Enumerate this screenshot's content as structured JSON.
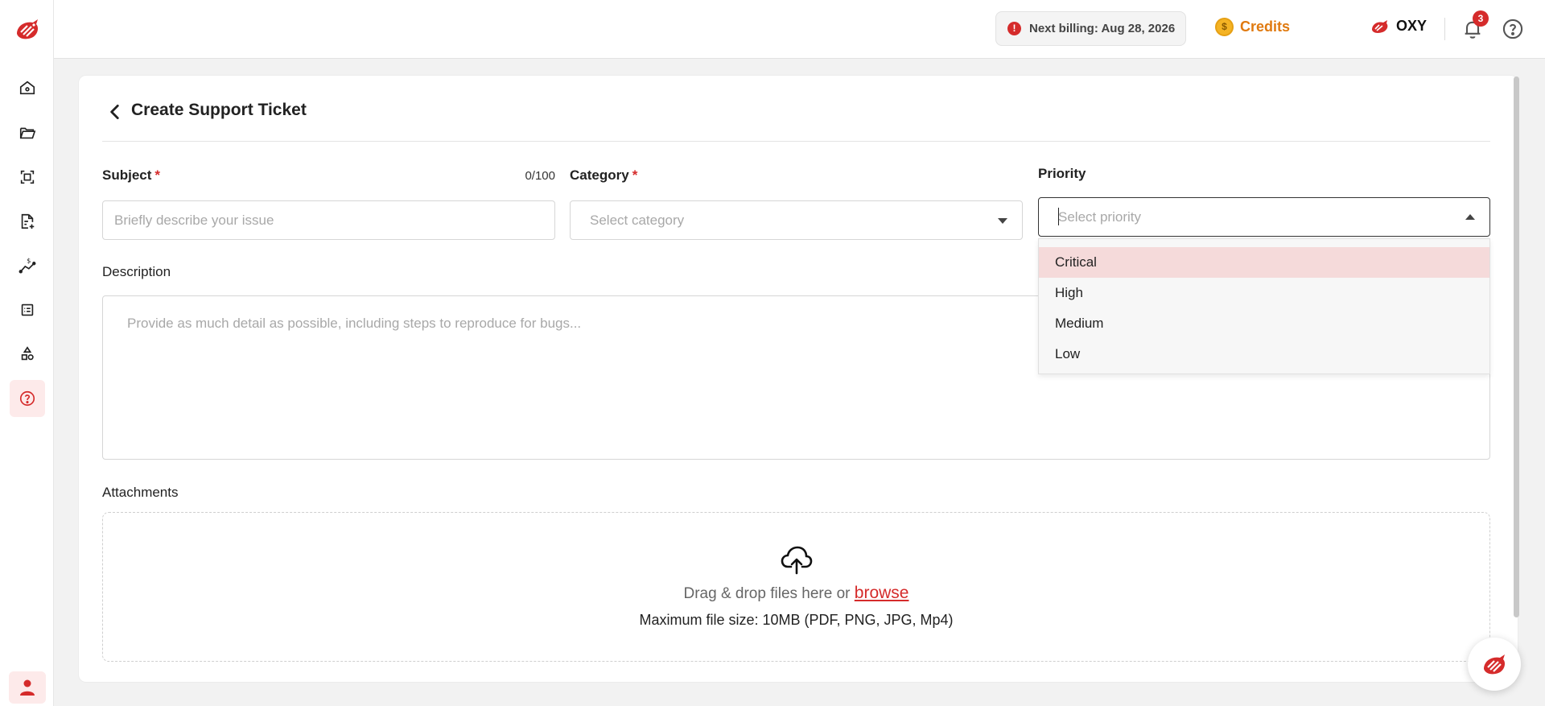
{
  "topbar": {
    "billing_text": "Next billing: Aug 28, 2026",
    "credits_label": "Credits",
    "brand_label": "OXY",
    "notification_count": "3"
  },
  "sidebar": {
    "items": [
      {
        "icon": "home-icon"
      },
      {
        "icon": "folder-icon"
      },
      {
        "icon": "scan-icon"
      },
      {
        "icon": "document-add-icon"
      },
      {
        "icon": "pricing-chart-icon"
      },
      {
        "icon": "table-list-icon"
      },
      {
        "icon": "shapes-icon"
      },
      {
        "icon": "help-circle-icon",
        "active": true
      }
    ]
  },
  "page": {
    "title": "Create Support Ticket"
  },
  "form": {
    "subject": {
      "label": "Subject",
      "required_mark": "*",
      "counter": "0/100",
      "placeholder": "Briefly describe your issue",
      "value": ""
    },
    "category": {
      "label": "Category",
      "required_mark": "*",
      "placeholder": "Select category"
    },
    "priority": {
      "label": "Priority",
      "placeholder": "Select priority",
      "options": [
        "Critical",
        "High",
        "Medium",
        "Low"
      ],
      "highlighted": "Critical"
    },
    "description": {
      "label": "Description",
      "placeholder": "Provide as much detail as possible, including steps to reproduce for bugs..."
    },
    "attachments": {
      "label": "Attachments",
      "drop_text": "Drag & drop files here or",
      "browse_label": "browse",
      "limit_text": "Maximum file size: 10MB (PDF, PNG, JPG, Mp4)"
    }
  },
  "colors": {
    "brand_red": "#d52b2b",
    "credits_orange": "#e07a10",
    "highlight": "#f5dada"
  }
}
